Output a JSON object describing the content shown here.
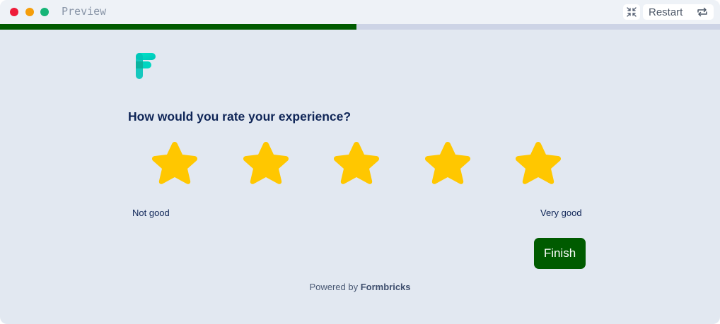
{
  "window": {
    "title": "Preview",
    "restart_label": "Restart",
    "minimize_icon": "collapse-arrows-icon",
    "restart_icon": "repeat-icon"
  },
  "progress": {
    "fraction": 0.495
  },
  "colors": {
    "brand": "#005b00",
    "star": "#ffc700",
    "question": "#0f2557",
    "background": "#e2e8f1"
  },
  "survey": {
    "question": "How would you rate your experience?",
    "rating_scale": 5,
    "low_label": "Not good",
    "high_label": "Very good",
    "finish_label": "Finish"
  },
  "footer": {
    "prefix": "Powered by ",
    "brand": "Formbricks"
  }
}
